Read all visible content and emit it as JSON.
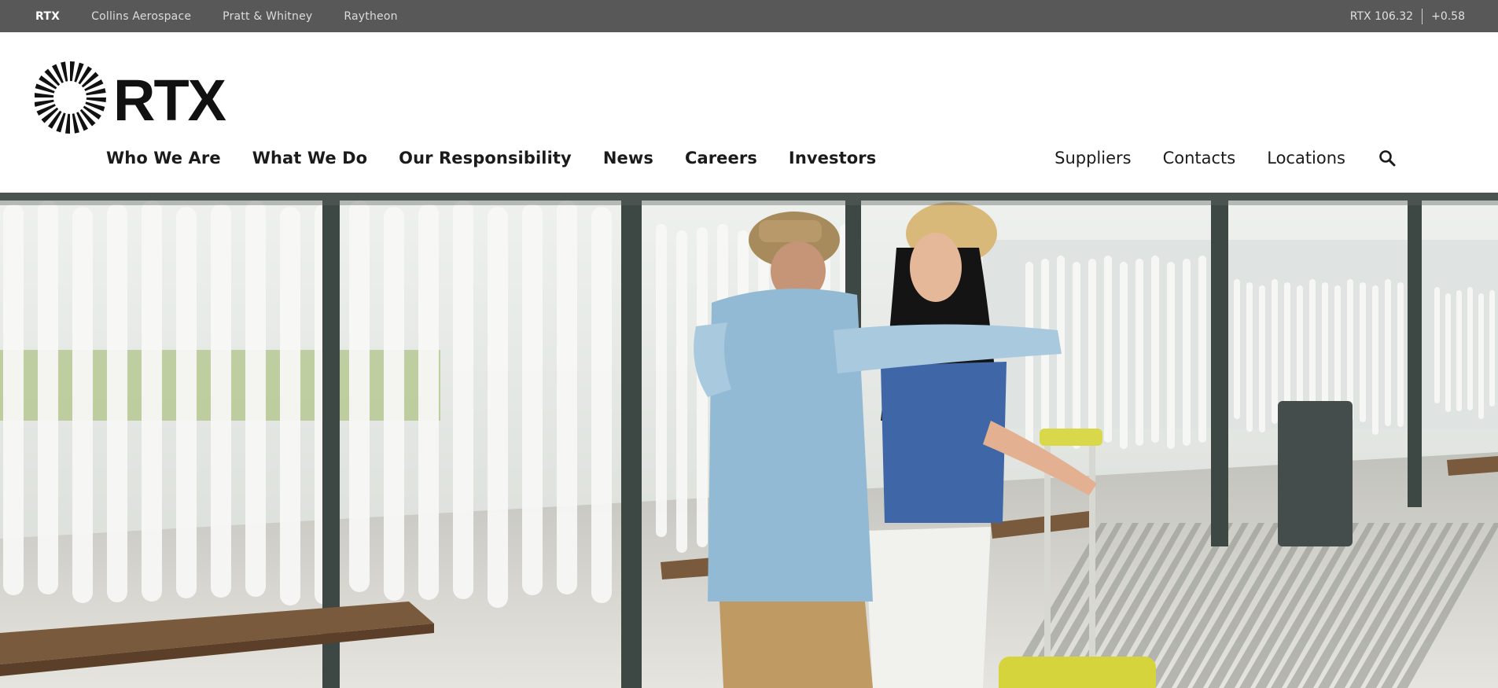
{
  "topbar": {
    "brands": [
      {
        "label": "RTX"
      },
      {
        "label": "Collins Aerospace"
      },
      {
        "label": "Pratt & Whitney"
      },
      {
        "label": "Raytheon"
      }
    ],
    "ticker": {
      "symbol_price": "RTX 106.32",
      "change": "+0.58"
    }
  },
  "header": {
    "logo_text": "RTX",
    "main_nav": [
      "Who We Are",
      "What We Do",
      "Our Responsibility",
      "News",
      "Careers",
      "Investors"
    ],
    "util_nav": [
      "Suppliers",
      "Contacts",
      "Locations"
    ],
    "search_icon": "search-icon"
  },
  "hero": {
    "media": "video-frame",
    "scene": "couple-embracing-at-bus-shelter"
  },
  "colors": {
    "topbar_bg": "#585858",
    "nav_text": "#1b1b1b",
    "logo": "#111111",
    "background": "#ffffff"
  }
}
